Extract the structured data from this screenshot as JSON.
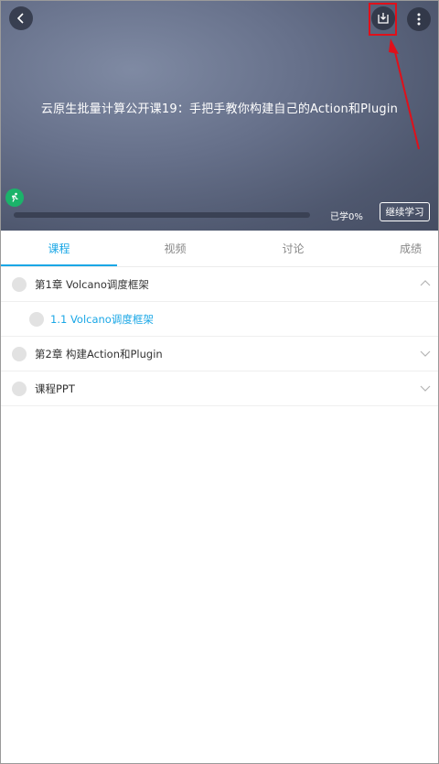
{
  "header": {
    "course_title": "云原生批量计算公开课19：手把手教你构建自己的Action和Plugin",
    "icons": {
      "back": "chevron-left-icon",
      "download": "download-icon",
      "more": "more-vertical-icon",
      "learner": "running-person-icon"
    }
  },
  "progress": {
    "text": "已学0%",
    "fraction": 0.0
  },
  "continue_button": "继续学习",
  "tabs": [
    {
      "label": "课程",
      "active": true
    },
    {
      "label": "视频",
      "active": false
    },
    {
      "label": "讨论",
      "active": false
    },
    {
      "label": "成绩",
      "active": false
    }
  ],
  "chapters": [
    {
      "label": "第1章 Volcano调度框架",
      "expanded": true
    },
    {
      "label": "1.1 Volcano调度框架",
      "sub": true
    },
    {
      "label": "第2章 构建Action和Plugin",
      "expanded": false
    },
    {
      "label": "课程PPT",
      "expanded": false
    }
  ],
  "colors": {
    "accent": "#1aa7e6",
    "progress": "#1bb36a",
    "highlight": "#e0101a"
  }
}
